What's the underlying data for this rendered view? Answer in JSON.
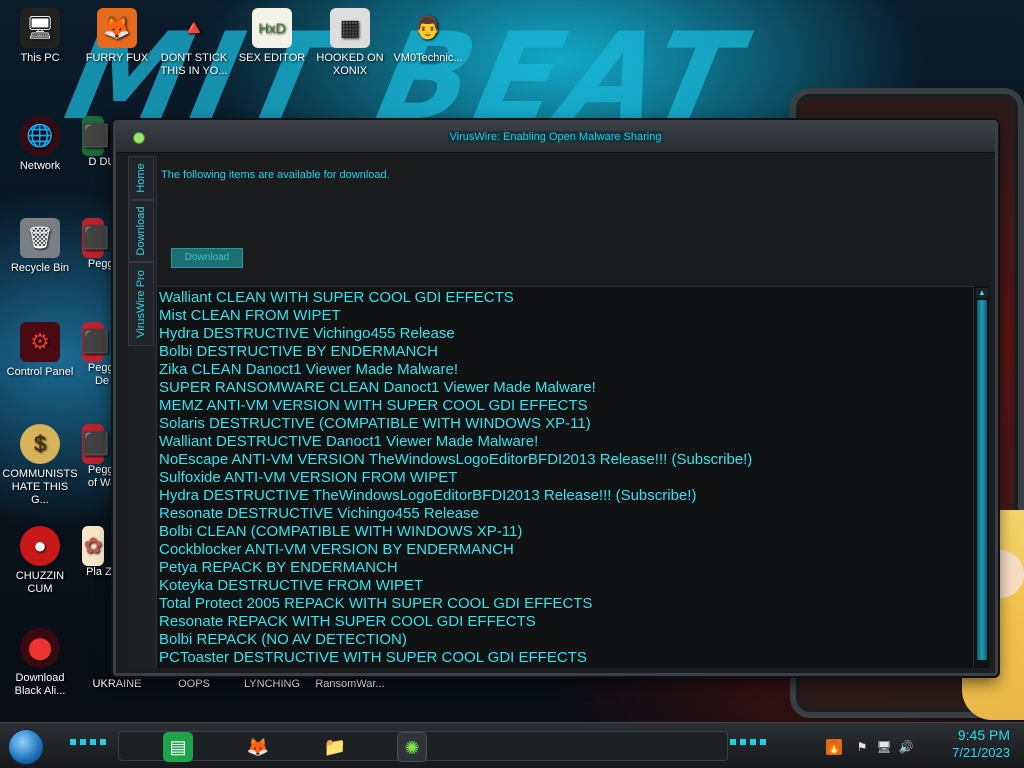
{
  "desktop": {
    "icons": [
      {
        "label": "This PC",
        "glyph": "🖥"
      },
      {
        "label": "FURRY FUX",
        "glyph": "🦊"
      },
      {
        "label": "DONT STICK THIS IN YO...",
        "glyph": "🔺"
      },
      {
        "label": "SEX EDITOR",
        "glyph": "HxD"
      },
      {
        "label": "HOOKED ON XONIX",
        "glyph": "▦"
      },
      {
        "label": "VM0Technic...",
        "glyph": "👨"
      },
      {
        "label": "Network",
        "glyph": "🌐"
      },
      {
        "label": "D DU",
        "glyph": "⬛"
      },
      {
        "label": "Recycle Bin",
        "glyph": "🗑"
      },
      {
        "label": "Peggl",
        "glyph": "⬛"
      },
      {
        "label": "Control Panel",
        "glyph": "⚙"
      },
      {
        "label": "Peggl De",
        "glyph": "⬛"
      },
      {
        "label": "COMMUNISTS HATE THIS G...",
        "glyph": "$"
      },
      {
        "label": "Peggl of Wa",
        "glyph": "⬛"
      },
      {
        "label": "CHUZZIN CUM",
        "glyph": "●"
      },
      {
        "label": "Pla Zo",
        "glyph": "✿"
      },
      {
        "label": "Download Black Ali...",
        "glyph": "⬤"
      },
      {
        "label": "UKRAINE",
        "glyph": "⬛"
      },
      {
        "label": "OOPS",
        "glyph": ""
      },
      {
        "label": "LYNCHING",
        "glyph": ""
      },
      {
        "label": "RansomWar...",
        "glyph": ""
      }
    ]
  },
  "wallpaper": {
    "title": "MIT BEAT"
  },
  "window": {
    "title": "VirusWire: Enabling Open Malware Sharing",
    "tabs": [
      "Home",
      "Download",
      "VirusWire Pro"
    ],
    "info_text": "The following items are available for download.",
    "download_button": "Download",
    "items": [
      "Walliant CLEAN WITH SUPER COOL GDI EFFECTS",
      "Mist CLEAN FROM WIPET",
      "Hydra DESTRUCTIVE Vichingo455 Release",
      "Bolbi DESTRUCTIVE BY ENDERMANCH",
      "Zika CLEAN Danoct1 Viewer Made Malware!",
      "SUPER RANSOMWARE CLEAN Danoct1 Viewer Made Malware!",
      "MEMZ ANTI-VM VERSION WITH SUPER COOL GDI EFFECTS",
      "Solaris DESTRUCTIVE (COMPATIBLE WITH WINDOWS XP-11)",
      "Walliant DESTRUCTIVE Danoct1 Viewer Made Malware!",
      "NoEscape ANTI-VM VERSION TheWindowsLogoEditorBFDI2013 Release!!! (Subscribe!)",
      "Sulfoxide ANTI-VM VERSION FROM WIPET",
      "Hydra DESTRUCTIVE TheWindowsLogoEditorBFDI2013 Release!!! (Subscribe!)",
      "Resonate DESTRUCTIVE Vichingo455 Release",
      "Bolbi CLEAN (COMPATIBLE WITH WINDOWS XP-11)",
      "Cockblocker ANTI-VM VERSION BY ENDERMANCH",
      "Petya REPACK BY ENDERMANCH",
      "Koteyka DESTRUCTIVE FROM WIPET",
      "Total Protect 2005 REPACK WITH SUPER COOL GDI EFFECTS",
      "Resonate REPACK WITH SUPER COOL GDI EFFECTS",
      "Bolbi REPACK (NO AV DETECTION)",
      "PCToaster DESTRUCTIVE WITH SUPER COOL GDI EFFECTS"
    ]
  },
  "taskbar": {
    "apps": [
      {
        "name": "notes",
        "glyph": "▤"
      },
      {
        "name": "firefox",
        "glyph": "🦊"
      },
      {
        "name": "explorer",
        "glyph": "📁"
      },
      {
        "name": "viruswire",
        "glyph": "✺"
      }
    ],
    "tray": [
      "🔥",
      "⚑",
      "🖥",
      "🔊"
    ],
    "time": "9:45 PM",
    "date": "7/21/2023"
  },
  "colors": {
    "accent": "#2fe5f0",
    "title_text": "#22c7e0",
    "window_bg": "#1b1d20"
  }
}
